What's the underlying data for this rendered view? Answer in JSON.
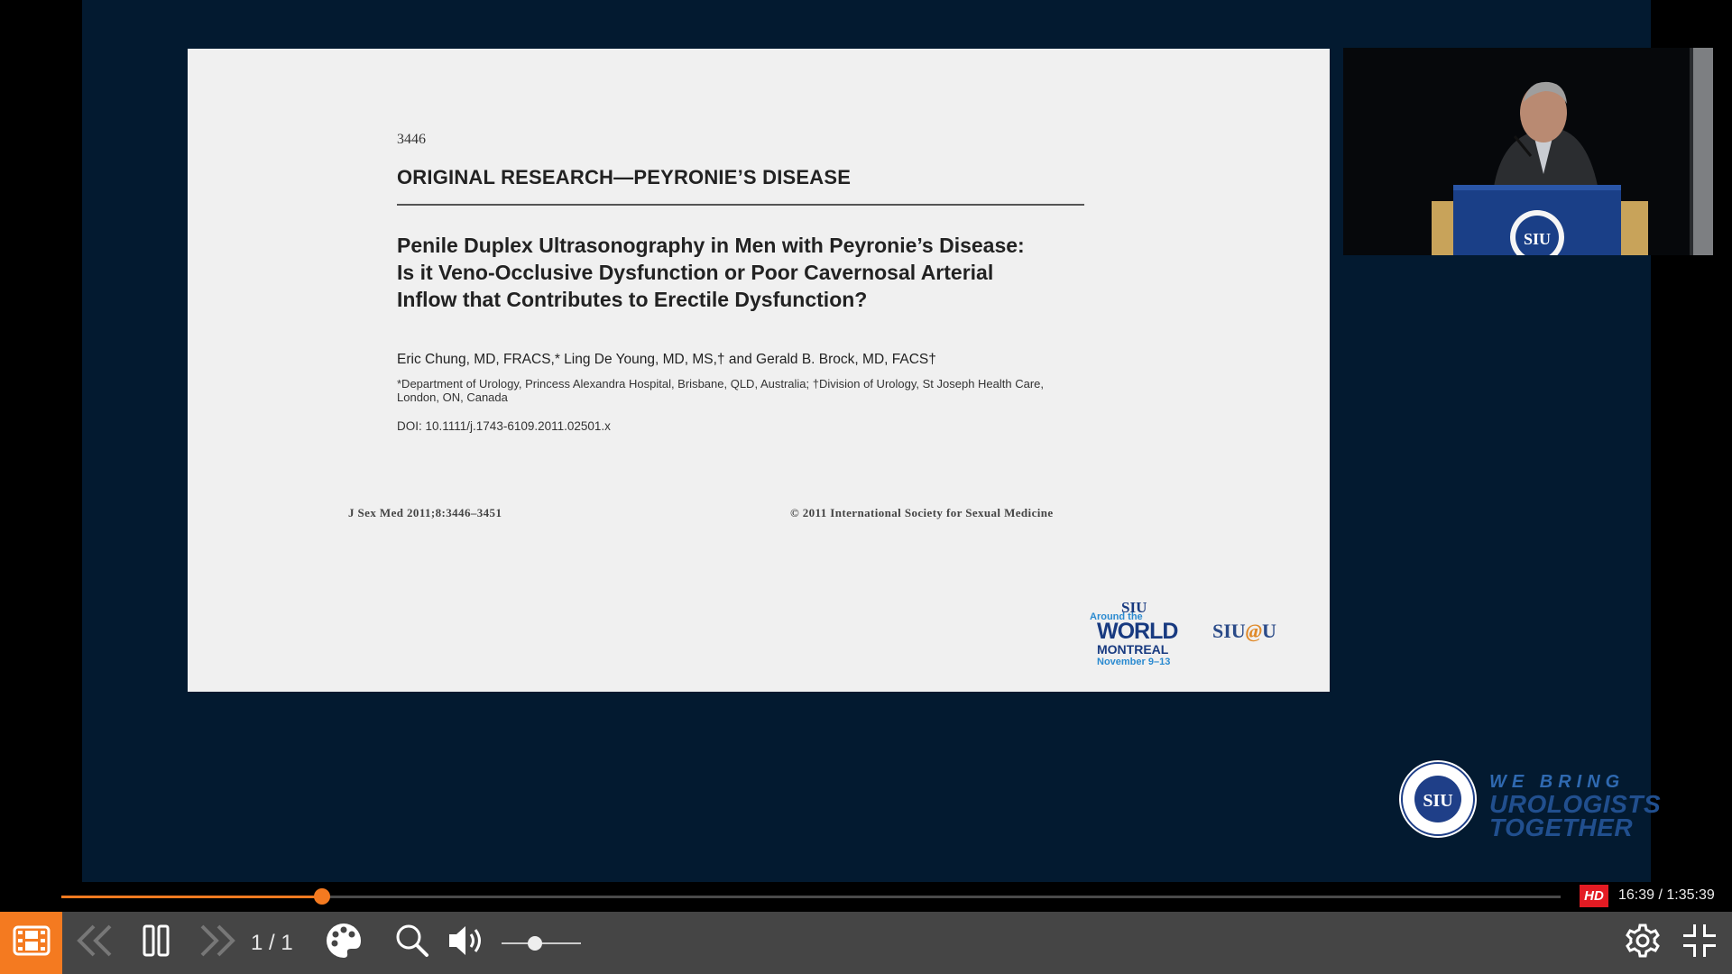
{
  "slide": {
    "page_number": "3446",
    "section": "ORIGINAL RESEARCH—PEYRONIE’S DISEASE",
    "title_lines": [
      "Penile Duplex Ultrasonography in Men with Peyronie’s Disease:",
      "Is it Veno-Occlusive Dysfunction or Poor Cavernosal Arterial",
      "Inflow that Contributes to Erectile Dysfunction?"
    ],
    "authors": "Eric Chung, MD, FRACS,* Ling De Young, MD, MS,† and Gerald B. Brock, MD, FACS†",
    "affiliation": "*Department of Urology, Princess Alexandra Hospital, Brisbane, QLD, Australia; †Division of Urology, St Joseph Health Care, London, ON, Canada",
    "doi": "DOI: 10.1111/j.1743-6109.2011.02501.x",
    "journal": "J Sex Med 2011;8:3446–3451",
    "copyright": "© 2011 International Society for Sexual Medicine",
    "logo_world": {
      "siu": "SIU",
      "around": "Around the",
      "world": "WORLD",
      "city": "MONTREAL",
      "dates": "November 9–13"
    },
    "logo_siuau": {
      "left": "SIU",
      "at": "@",
      "right": "U"
    }
  },
  "camera": {
    "podium_seal": "SIU"
  },
  "brand": {
    "seal_text": "SIU",
    "line1": "WE BRING",
    "line2": "UROLOGISTS",
    "line3": "TOGETHER"
  },
  "player": {
    "progress_fraction": 0.174,
    "quality_badge": "HD",
    "time": "16:39 / 1:35:39",
    "page_counter": "1 / 1",
    "volume_fraction": 0.42,
    "accent_color": "#f47a20",
    "icons": {
      "slides": "film-slides-icon",
      "prev": "double-chevron-left-icon",
      "pause": "pause-icon",
      "next": "double-chevron-right-icon",
      "theme": "palette-icon",
      "zoom": "magnifier-icon",
      "volume": "speaker-icon",
      "settings": "gear-icon",
      "exit_fullscreen": "exit-fullscreen-icon"
    }
  }
}
